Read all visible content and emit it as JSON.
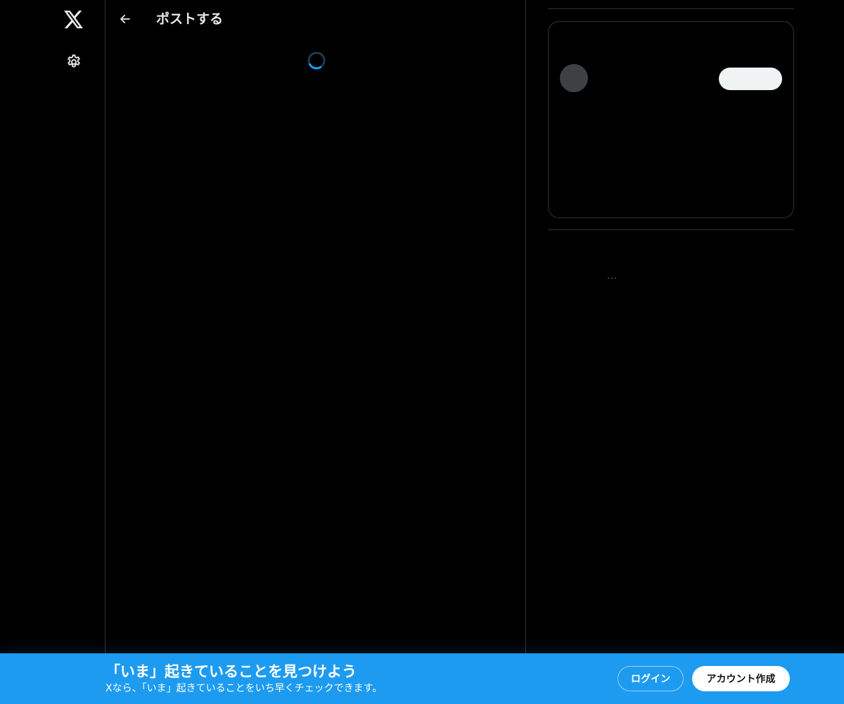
{
  "header": {
    "title": "ポストする"
  },
  "right_sidebar": {
    "loading_indicator": "..."
  },
  "banner": {
    "title": "「いま」起きていることを見つけよう",
    "subtitle": "Xなら、「いま」起きていることをいち早くチェックできます。",
    "login_label": "ログイン",
    "signup_label": "アカウント作成"
  },
  "icons": {
    "logo": "x-logo-icon",
    "settings": "gear-icon",
    "back": "arrow-left-icon",
    "spinner": "loading-spinner-icon"
  },
  "colors": {
    "background": "#000000",
    "border": "#2f3336",
    "text_primary": "#e7e9ea",
    "accent": "#1d9bf0",
    "placeholder_avatar": "#3e4144",
    "placeholder_pill": "#eff3f4"
  }
}
